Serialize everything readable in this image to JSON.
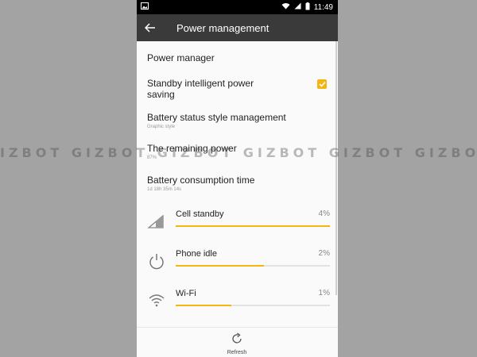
{
  "status_bar": {
    "time": "11:49"
  },
  "header": {
    "title": "Power management"
  },
  "settings": {
    "power_manager": {
      "label": "Power manager"
    },
    "standby": {
      "label_line1": "Standby intelligent power",
      "label_line2": "saving",
      "checked": true
    },
    "battery_style": {
      "label": "Battery status style management",
      "sub": "Graphic style"
    },
    "remaining_power": {
      "label": "The remaining power",
      "sub": "87%"
    },
    "consumption_time": {
      "label": "Battery consumption time",
      "sub": "1d 18h 35m 14s"
    }
  },
  "usage": [
    {
      "name": "Cell standby",
      "percent_label": "4%",
      "bar_fraction": 1.0,
      "icon": "cell-signal-icon"
    },
    {
      "name": "Phone idle",
      "percent_label": "2%",
      "bar_fraction": 0.57,
      "icon": "power-icon"
    },
    {
      "name": "Wi-Fi",
      "percent_label": "1%",
      "bar_fraction": 0.36,
      "icon": "wifi-icon"
    }
  ],
  "bottom": {
    "refresh_label": "Refresh"
  },
  "watermark": {
    "text": "IZBOT GIZBOT GIZBOT GIZBOT GIZBOT GIZBOT"
  },
  "colors": {
    "accent": "#f5b511",
    "header": "#3a3a3a",
    "status_bar": "#000000"
  }
}
